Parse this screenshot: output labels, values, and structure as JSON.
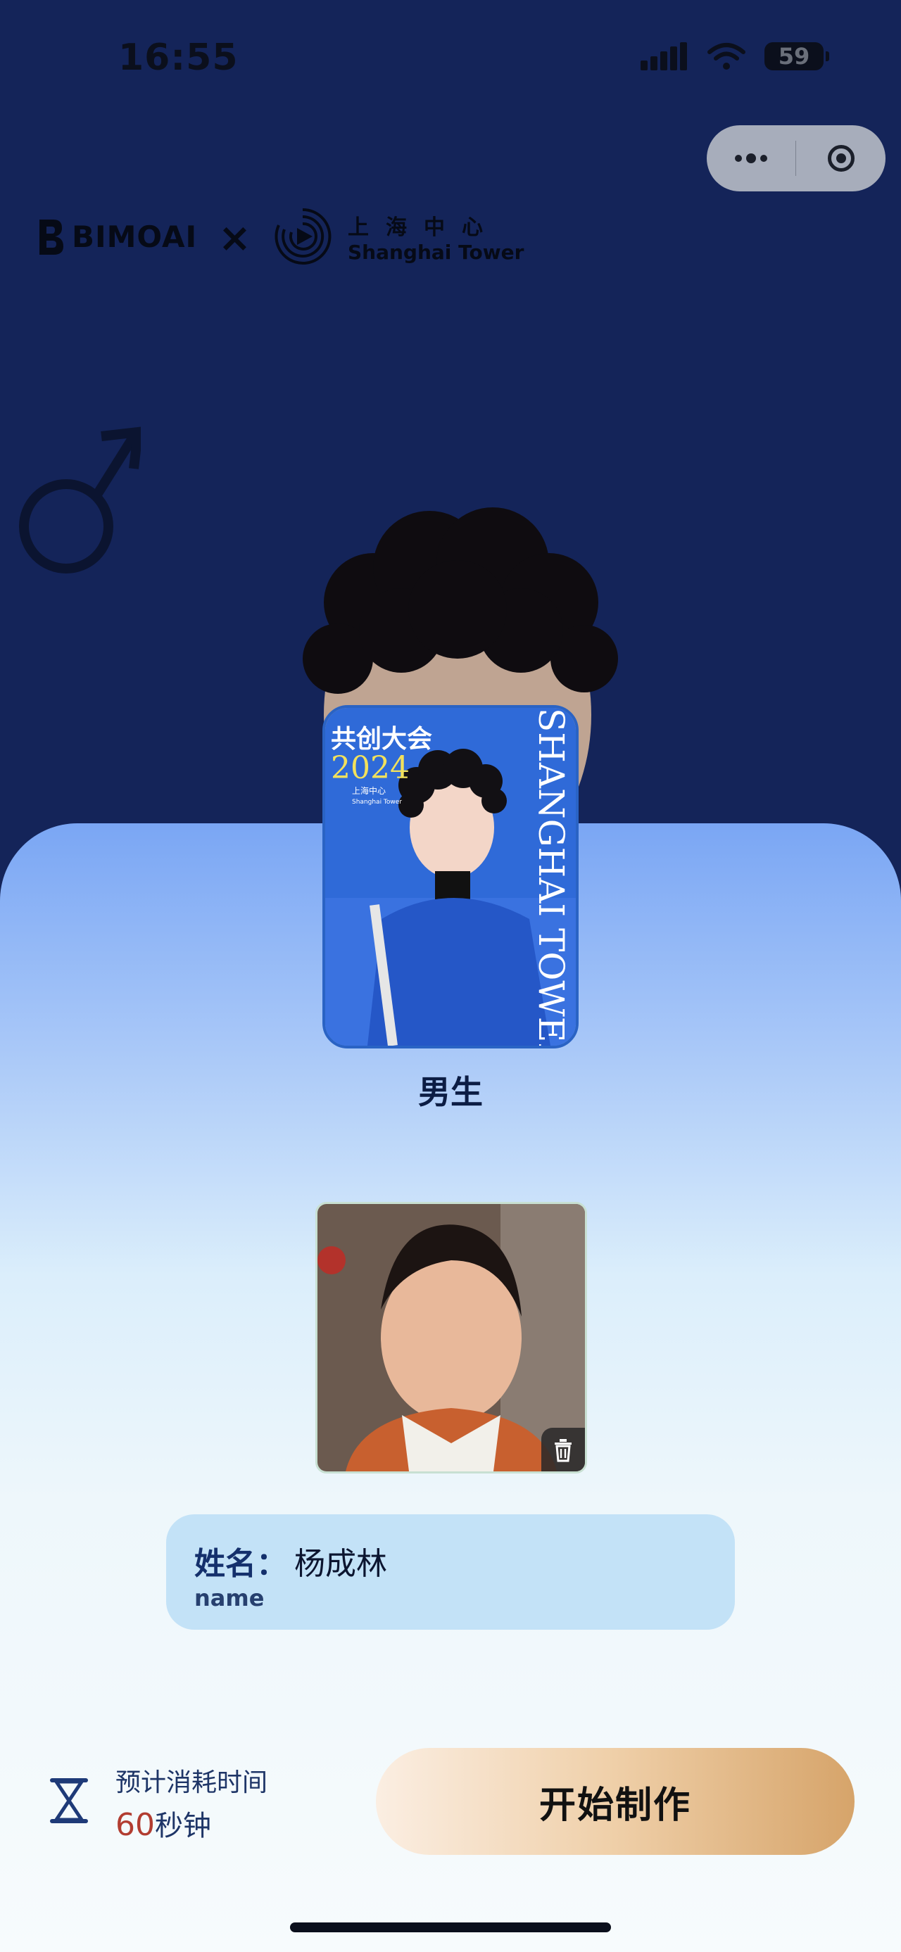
{
  "status_bar": {
    "time": "16:55",
    "battery": "59"
  },
  "brand": {
    "bimo": "BIMOAI",
    "separator": "×",
    "tower_cn": "上海中心",
    "tower_en": "Shanghai Tower"
  },
  "poster": {
    "line1": "共创大会",
    "year": "2024",
    "side_text": "SHANGHAI TOWER",
    "logo_cn": "上海中心",
    "logo_en": "Shanghai Tower"
  },
  "selection": {
    "gender_label": "男生"
  },
  "name_card": {
    "key": "姓名：",
    "value": "杨成林",
    "sub": "name"
  },
  "footer": {
    "time_label": "预计消耗时间",
    "time_number": "60",
    "time_unit": "秒钟",
    "start_button": "开始制作"
  }
}
